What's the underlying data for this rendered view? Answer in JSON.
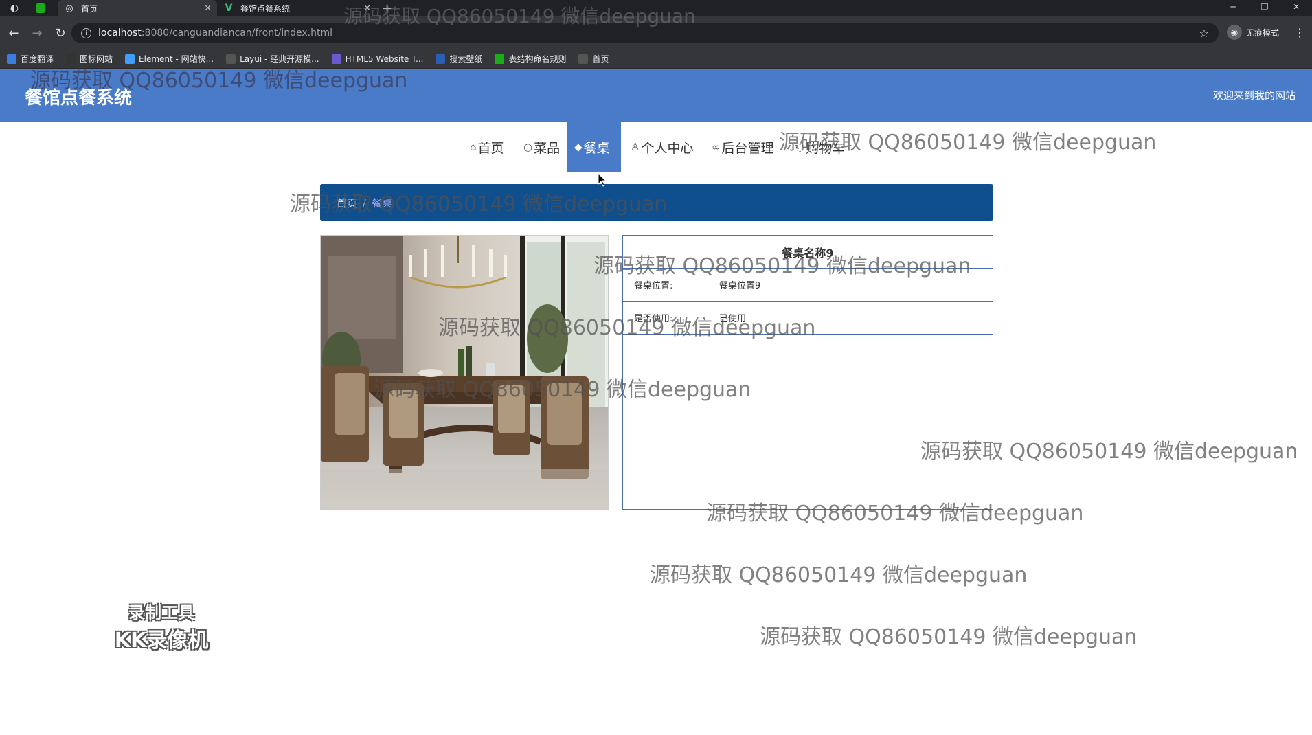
{
  "browser": {
    "tabs": [
      {
        "title": "首页",
        "active": true
      },
      {
        "title": "餐馆点餐系统",
        "active": false
      }
    ],
    "new_tab_symbol": "+",
    "url_host": "localhost",
    "url_rest": ":8080/canguandiancan/front/index.html",
    "incognito_label": "无痕模式",
    "bookmarks": [
      {
        "label": "百度翻译",
        "icon": "translate-icon",
        "color": "#3b7de0"
      },
      {
        "label": "图标网站",
        "icon": "flag-icon",
        "color": "#333333"
      },
      {
        "label": "Element - 网站快...",
        "icon": "element-icon",
        "color": "#409eff"
      },
      {
        "label": "Layui - 经典开源模...",
        "icon": "layui-icon",
        "color": "#555555"
      },
      {
        "label": "HTML5 Website T...",
        "icon": "html5-icon",
        "color": "#6a5acd"
      },
      {
        "label": "搜索壁纸",
        "icon": "wallpaper-icon",
        "color": "#2b5fb3"
      },
      {
        "label": "表结构命名规则",
        "icon": "sheet-icon",
        "color": "#1aad19"
      },
      {
        "label": "首页",
        "icon": "globe-icon",
        "color": "#555555"
      }
    ]
  },
  "site": {
    "title": "餐馆点餐系统",
    "welcome": "欢迎来到我的网站",
    "accent": "#4a7bc8"
  },
  "nav": [
    {
      "label": "首页",
      "icon": "home-icon",
      "glyph": "⌂",
      "active": false
    },
    {
      "label": "菜品",
      "icon": "circle-icon",
      "glyph": "○",
      "active": false
    },
    {
      "label": "餐桌",
      "icon": "layers-icon",
      "glyph": "◆",
      "active": true
    },
    {
      "label": "个人中心",
      "icon": "user-icon",
      "glyph": "♙",
      "active": false
    },
    {
      "label": "后台管理",
      "icon": "link-icon",
      "glyph": "∞",
      "active": false
    },
    {
      "label": "购物车",
      "icon": "cart-icon",
      "glyph": "◌",
      "active": false
    }
  ],
  "breadcrumb": {
    "home": "首页",
    "separator": "/",
    "current": "餐桌"
  },
  "detail": {
    "name": "餐桌名称9",
    "fields": [
      {
        "label": "餐桌位置:",
        "value": "餐桌位置9"
      },
      {
        "label": "是否使用:",
        "value": "已使用"
      }
    ]
  },
  "watermark_text": "源码获取 QQ86050149 微信deepguan",
  "recorder": {
    "line1": "录制工具",
    "line2": "KK录像机"
  }
}
